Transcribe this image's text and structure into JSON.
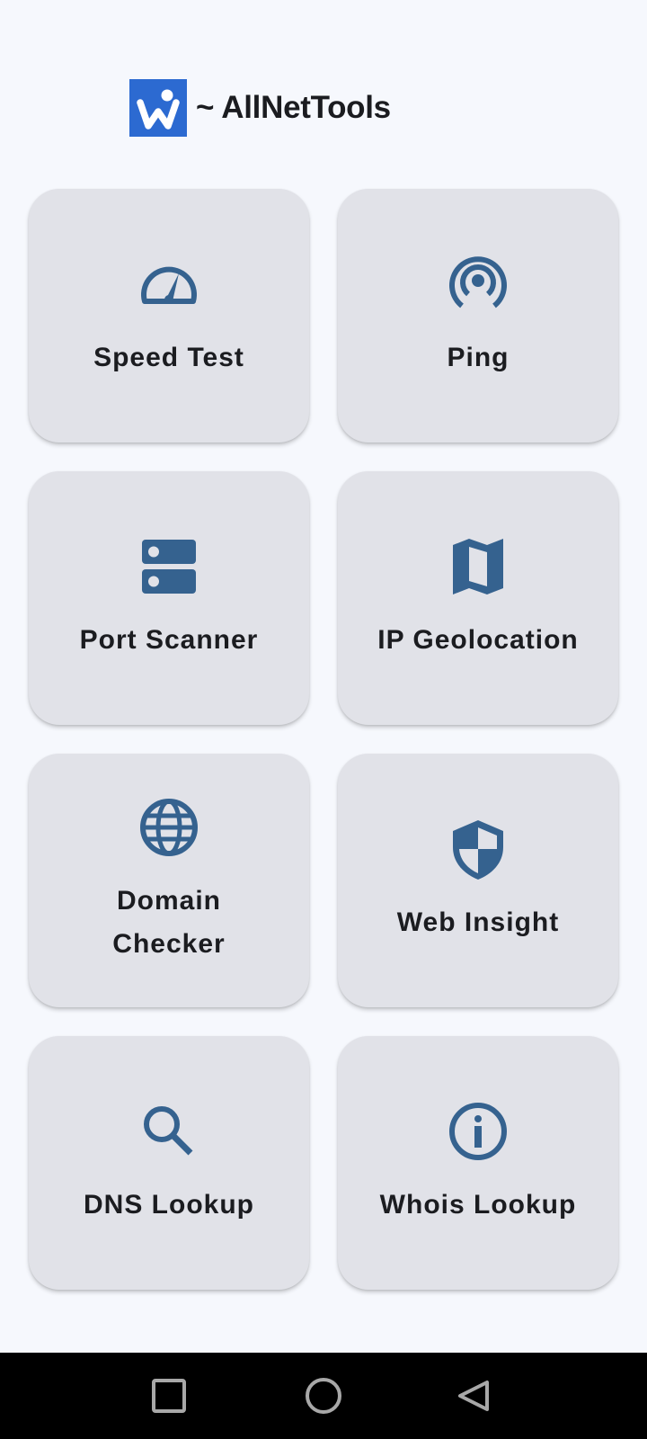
{
  "app": {
    "title": "~ AllNetTools",
    "logo_icon": "w-logo-icon",
    "logo_color": "#2c6ad1"
  },
  "colors": {
    "background": "#f6f8fd",
    "card": "#e1e2e8",
    "icon": "#35628f",
    "text": "#1b1c20",
    "nav_bar": "#000000",
    "nav_icon": "#a8a8a8"
  },
  "tools": [
    {
      "label": "Speed Test",
      "icon": "speedometer-icon"
    },
    {
      "label": "Ping",
      "icon": "ping-signal-icon"
    },
    {
      "label": "Port Scanner",
      "icon": "server-icon"
    },
    {
      "label": "IP Geolocation",
      "icon": "map-icon"
    },
    {
      "label": "Domain Checker",
      "icon": "globe-icon"
    },
    {
      "label": "Web Insight",
      "icon": "shield-icon"
    },
    {
      "label": "DNS Lookup",
      "icon": "search-icon"
    },
    {
      "label": "Whois Lookup",
      "icon": "info-icon"
    }
  ],
  "nav": {
    "recents_icon": "square-icon",
    "home_icon": "circle-icon",
    "back_icon": "triangle-back-icon"
  }
}
